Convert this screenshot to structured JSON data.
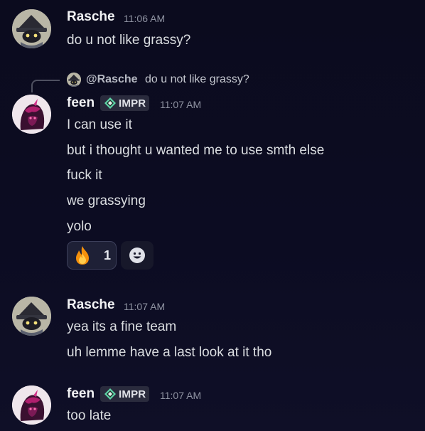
{
  "messages": [
    {
      "username": "Rasche",
      "timestamp": "11:06 AM",
      "lines": [
        "do u not like grassy?"
      ]
    },
    {
      "reply": {
        "username": "@Rasche",
        "text": "do u not like grassy?"
      },
      "username": "feen",
      "tag": "IMPR",
      "timestamp": "11:07 AM",
      "lines": [
        "I can use it",
        "but i thought u wanted me to use smth else",
        "fuck it",
        "we grassying",
        "yolo"
      ],
      "reactions": [
        {
          "emoji": "fire-emoji",
          "count": "1"
        }
      ]
    },
    {
      "username": "Rasche",
      "timestamp": "11:07 AM",
      "lines": [
        "yea its a fine team",
        "uh lemme have a last look at it tho"
      ]
    },
    {
      "username": "feen",
      "tag": "IMPR",
      "timestamp": "11:07 AM",
      "lines": [
        "too late"
      ]
    }
  ],
  "colors": {
    "background": "#0c0c22",
    "username": "#f2f3f5",
    "text": "#dbdee1",
    "timestamp": "#8f93a2",
    "reaction_bg": "#1e2036",
    "reaction_border": "#3c3f5a",
    "tag_bg": "#2a2b3d"
  }
}
